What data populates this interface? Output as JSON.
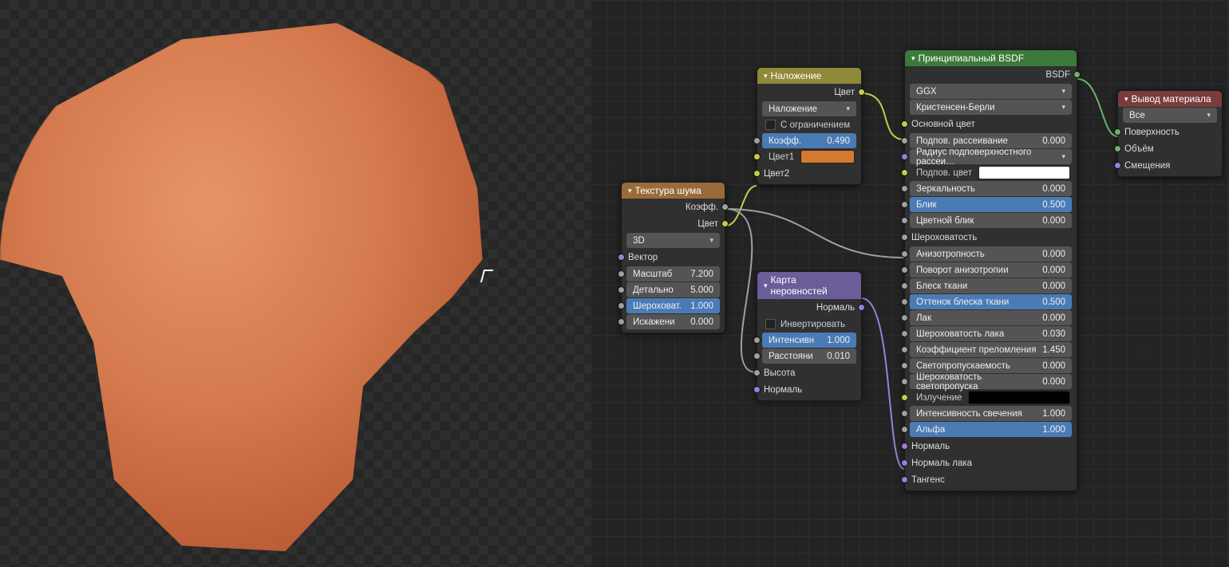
{
  "nodes": {
    "noise": {
      "title": "Текстура шума",
      "out_fac": "Коэфф.",
      "out_color": "Цвет",
      "dim_select": "3D",
      "in_vector": "Вектор",
      "scale": {
        "label": "Масштаб",
        "value": "7.200"
      },
      "detail": {
        "label": "Детально",
        "value": "5.000"
      },
      "roughness": {
        "label": "Шероховат.",
        "value": "1.000"
      },
      "distortion": {
        "label": "Искажени",
        "value": "0.000"
      }
    },
    "mix": {
      "title": "Наложение",
      "out_color": "Цвет",
      "blend_select": "Наложение",
      "clamp": "С ограничением",
      "fac": {
        "label": "Коэфф.",
        "value": "0.490"
      },
      "color1": "Цвет1",
      "color1_hex": "#d47a2e",
      "color2": "Цвет2"
    },
    "bump": {
      "title": "Карта неровностей",
      "out_normal": "Нормаль",
      "invert": "Инвертировать",
      "strength": {
        "label": "Интенсивн",
        "value": "1.000"
      },
      "distance": {
        "label": "Расстояни",
        "value": "0.010"
      },
      "height": "Высота",
      "normal": "Нормаль"
    },
    "bsdf": {
      "title": "Принципиальный BSDF",
      "out_bsdf": "BSDF",
      "distribution": "GGX",
      "subsurface_method": "Кристенсен-Берли",
      "base_color": "Основной цвет",
      "subsurface": {
        "label": "Подпов. рассеивание",
        "value": "0.000"
      },
      "subsurface_radius": "Радиус подповерхностного рассеи…",
      "subsurface_color": "Подпов. цвет",
      "subsurface_color_hex": "#ffffff",
      "specular": {
        "label": "Зеркальность",
        "value": "0.000"
      },
      "specular_glint": {
        "label": "Блик",
        "value": "0.500"
      },
      "specular_tint": {
        "label": "Цветной блик",
        "value": "0.000"
      },
      "roughness": "Шероховатость",
      "anisotropic": {
        "label": "Анизотропность",
        "value": "0.000"
      },
      "aniso_rotation": {
        "label": "Поворот анизотропии",
        "value": "0.000"
      },
      "sheen": {
        "label": "Блеск ткани",
        "value": "0.000"
      },
      "sheen_tint": {
        "label": "Оттенок блеска ткани",
        "value": "0.500"
      },
      "clearcoat": {
        "label": "Лак",
        "value": "0.000"
      },
      "clearcoat_rough": {
        "label": "Шероховатость лака",
        "value": "0.030"
      },
      "ior": {
        "label": "Коэффициент преломления",
        "value": "1.450"
      },
      "transmission": {
        "label": "Светопропускаемость",
        "value": "0.000"
      },
      "trans_rough": {
        "label": "Шероховатость светопропуска",
        "value": "0.000"
      },
      "emission": "Излучение",
      "emission_hex": "#000000",
      "emission_strength": {
        "label": "Интенсивность свечения",
        "value": "1.000"
      },
      "alpha": {
        "label": "Альфа",
        "value": "1.000"
      },
      "normal": "Нормаль",
      "clearcoat_normal": "Нормаль лака",
      "tangent": "Тангенс"
    },
    "output": {
      "title": "Вывод материала",
      "target": "Все",
      "surface": "Поверхность",
      "volume": "Объём",
      "displacement": "Смещения"
    }
  }
}
